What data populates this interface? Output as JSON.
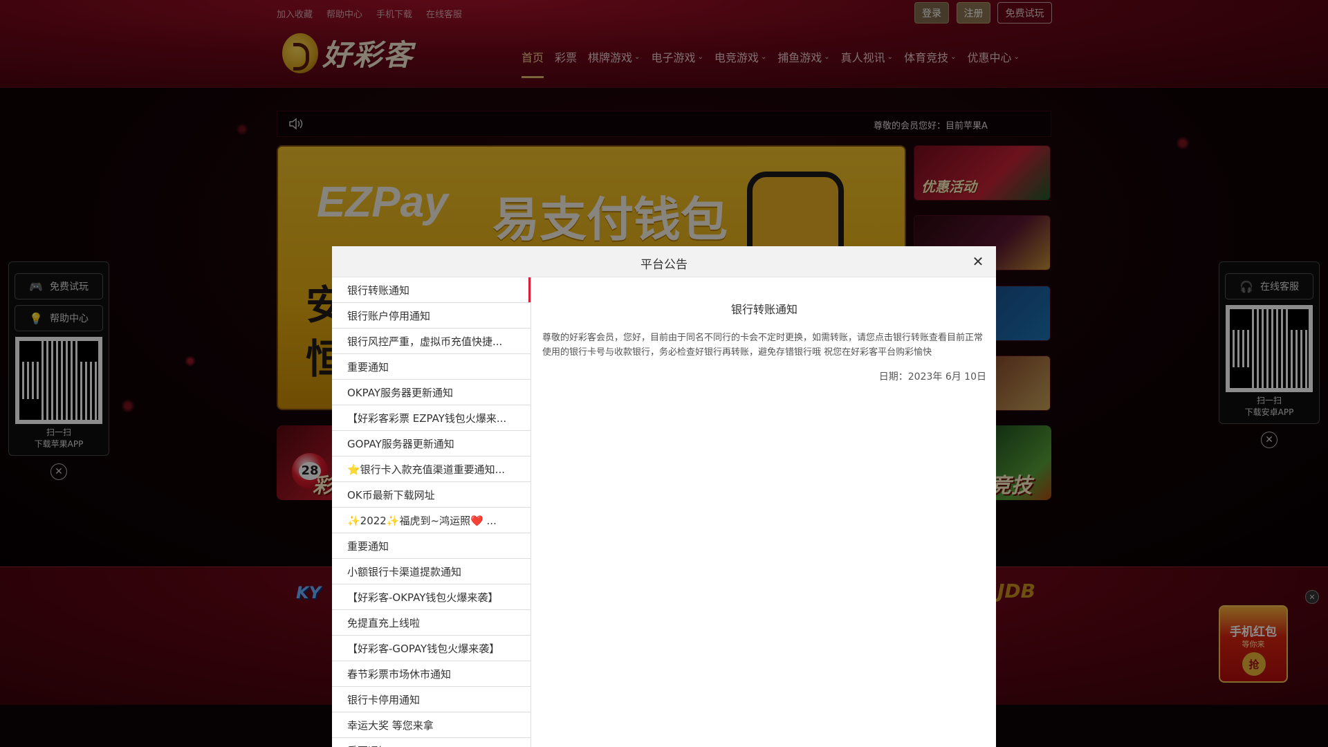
{
  "topbar": {
    "links": [
      "加入收藏",
      "帮助中心",
      "手机下载",
      "在线客服"
    ],
    "login": "登录",
    "register": "注册",
    "free_trial": "免费试玩"
  },
  "brand": {
    "name": "好彩客"
  },
  "nav": [
    {
      "label": "首页",
      "dropdown": false,
      "active": true
    },
    {
      "label": "彩票",
      "dropdown": false,
      "active": false
    },
    {
      "label": "棋牌游戏",
      "dropdown": true,
      "active": false
    },
    {
      "label": "电子游戏",
      "dropdown": true,
      "active": false
    },
    {
      "label": "电竞游戏",
      "dropdown": true,
      "active": false
    },
    {
      "label": "捕鱼游戏",
      "dropdown": true,
      "active": false
    },
    {
      "label": "真人视讯",
      "dropdown": true,
      "active": false
    },
    {
      "label": "体育竞技",
      "dropdown": true,
      "active": false
    },
    {
      "label": "优惠中心",
      "dropdown": true,
      "active": false
    }
  ],
  "marquee": {
    "text": "尊敬的会员您好：目前苹果A"
  },
  "banner": {
    "ez": "EZ",
    "pay": "Pay",
    "cn": "易支付钱包",
    "side1": "安",
    "side2": "恒"
  },
  "thumbs": {
    "promo": "优惠活动"
  },
  "cards": {
    "ball_number": "28",
    "left": "彩",
    "right": "竞技"
  },
  "footer": {
    "ky": "KY",
    "jdb": "JDB"
  },
  "left_panel": {
    "trial_btn": "免费试玩",
    "help_btn": "帮助中心",
    "scan": "扫一扫",
    "caption": "下载苹果APP"
  },
  "right_panel": {
    "service_btn": "在线客服",
    "scan": "扫一扫",
    "caption": "下载安卓APP"
  },
  "red_envelope": {
    "title": "手机红包",
    "sub": "等你来",
    "grab": "抢"
  },
  "modal": {
    "title": "平台公告",
    "items": [
      "银行转账通知",
      "银行账户停用通知",
      "银行风控严重，虚拟币充值快捷...",
      "重要通知",
      "OKPAY服务器更新通知",
      "【好彩客彩票 EZPAY钱包火爆来...",
      "GOPAY服务器更新通知",
      "⭐银行卡入款充值渠道重要通知...",
      "OK币最新下载网址",
      "✨2022✨福虎到~鸿运照❤️ ...",
      "重要通知",
      "小额银行卡渠道提款通知",
      "【好彩客-OKPAY钱包火爆来袭】",
      "免提直充上线啦",
      "【好彩客-GOPAY钱包火爆来袭】",
      "春节彩票市场休市通知",
      "银行卡停用通知",
      "幸运大奖 等您来拿",
      "重要通知"
    ],
    "active_index": 0,
    "content_title": "银行转账通知",
    "content_body": "尊敬的好彩客会员，您好，目前由于同名不同行的卡会不定时更换，如需转账，请您点击银行转账查看目前正常使用的银行卡号与收款银行，务必检查好银行再转账，避免存错银行哦 祝您在好彩客平台购彩愉快",
    "content_date": "日期：2023年 6月 10日"
  },
  "colors": {
    "accent_red": "#d6203a",
    "header_red": "#6b0717",
    "gold": "#e1b86d"
  }
}
